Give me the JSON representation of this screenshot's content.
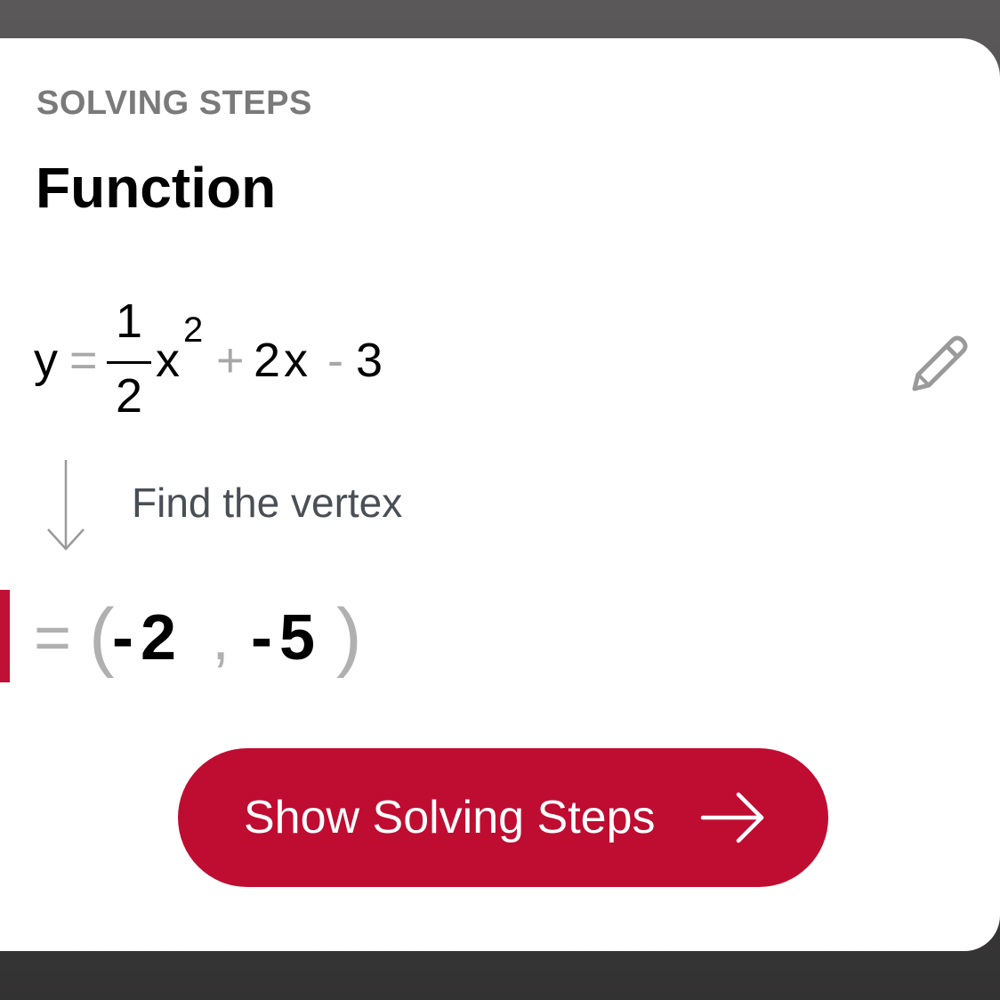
{
  "header": {
    "section_label": "SOLVING STEPS",
    "title": "Function"
  },
  "expression": {
    "lhs": "y",
    "equals": "=",
    "frac_numerator": "1",
    "frac_denominator": "2",
    "var": "x",
    "exponent": "2",
    "plus": "+",
    "term2": "2x",
    "minus": "-",
    "constant": "3",
    "edit_icon": "pencil-icon"
  },
  "step": {
    "arrow_icon": "arrow-down-icon",
    "description": "Find the vertex"
  },
  "result": {
    "equals": "=",
    "open_paren": "(",
    "x": "-2",
    "comma": ",",
    "y": "-5",
    "close_paren": ")"
  },
  "cta": {
    "label": "Show Solving Steps",
    "icon": "arrow-right-icon"
  },
  "colors": {
    "accent": "#bf0d32",
    "muted_operator": "#a8a8a8",
    "section_label": "#7a7a7a",
    "step_text": "#4a4e55",
    "card_background": "#ffffff",
    "backdrop": "#4a4848"
  }
}
